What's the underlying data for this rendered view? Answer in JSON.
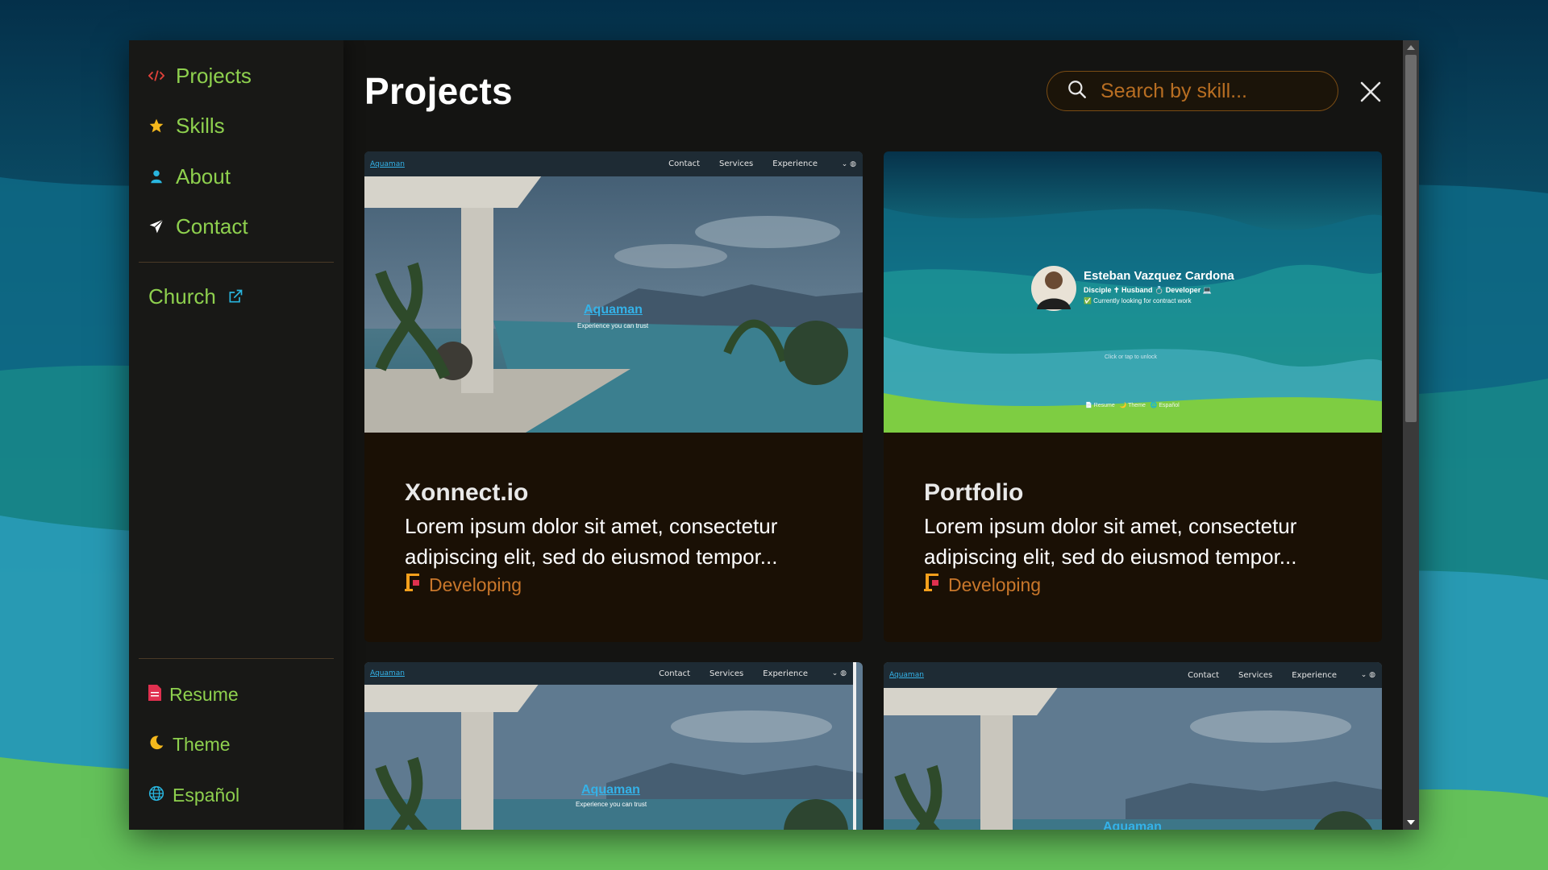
{
  "sidebar": {
    "nav": [
      {
        "label": "Projects",
        "icon": "code-icon"
      },
      {
        "label": "Skills",
        "icon": "star-icon"
      },
      {
        "label": "About",
        "icon": "person-icon"
      },
      {
        "label": "Contact",
        "icon": "paper-plane-icon"
      }
    ],
    "external": {
      "label": "Church",
      "icon": "external-link-icon"
    },
    "bottom": [
      {
        "label": "Resume",
        "icon": "document-icon"
      },
      {
        "label": "Theme",
        "icon": "moon-icon"
      },
      {
        "label": "Español",
        "icon": "globe-icon"
      }
    ]
  },
  "main": {
    "title": "Projects",
    "search": {
      "placeholder": "Search by skill..."
    },
    "projects": [
      {
        "title": "Xonnect.io",
        "description": "Lorem ipsum dolor sit amet, consectetur adipiscing elit, sed do eiusmod tempor...",
        "status": "Developing",
        "preview": {
          "logo": "Aquaman",
          "links": [
            "Contact",
            "Services",
            "Experience"
          ],
          "brand": "Aquaman",
          "tagline": "Experience you can trust"
        }
      },
      {
        "title": "Portfolio",
        "description": "Lorem ipsum dolor sit amet, consectetur adipiscing elit, sed do eiusmod tempor...",
        "status": "Developing",
        "preview": {
          "name": "Esteban Vazquez Cardona",
          "roles": "Disciple ✝ Husband 💍 Developer 💻",
          "availability": "✅ Currently looking for contract work",
          "hint": "Click or tap to unlock",
          "footer": "📄 Resume   🌙 Theme   🌐 Español"
        }
      },
      {
        "preview": {
          "logo": "Aquaman",
          "links": [
            "Contact",
            "Services",
            "Experience"
          ],
          "brand": "Aquaman",
          "tagline": "Experience you can trust"
        }
      },
      {
        "preview": {
          "logo": "Aquaman",
          "links": [
            "Contact",
            "Services",
            "Experience"
          ],
          "brand": "Aquaman"
        }
      }
    ]
  },
  "colors": {
    "accent_green": "#8ed04e",
    "accent_orange": "#c9772b",
    "card_bg": "#1a1005",
    "panel_bg": "#141412"
  }
}
